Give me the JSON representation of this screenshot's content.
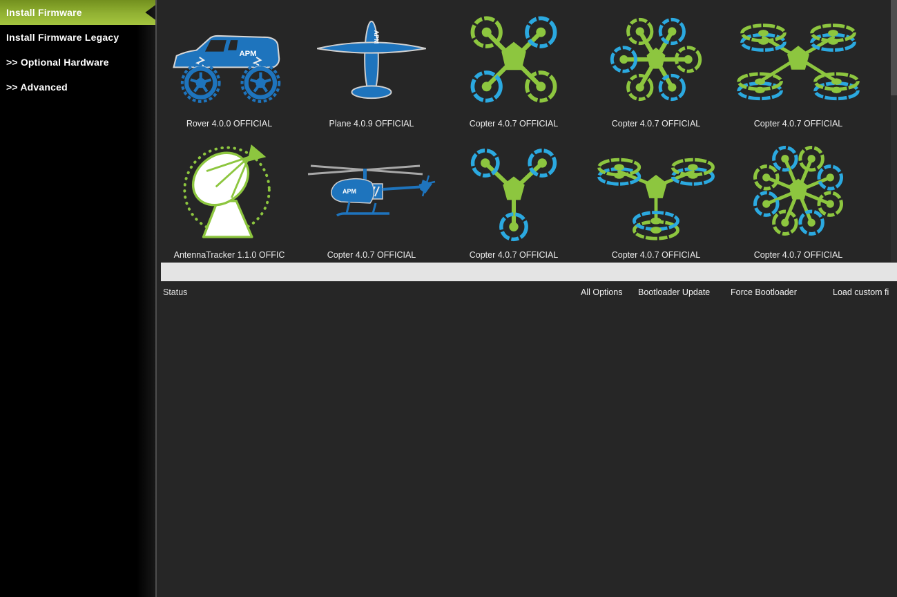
{
  "sidebar": {
    "items": [
      {
        "label": "Install Firmware",
        "selected": true
      },
      {
        "label": "Install Firmware Legacy",
        "selected": false
      },
      {
        "label": ">> Optional Hardware",
        "selected": false
      },
      {
        "label": ">> Advanced",
        "selected": false
      }
    ]
  },
  "firmware_grid": {
    "tiles": [
      {
        "label": "Rover 4.0.0 OFFICIAL",
        "vehicle": "rover"
      },
      {
        "label": "Plane 4.0.9 OFFICIAL",
        "vehicle": "plane"
      },
      {
        "label": "Copter 4.0.7 OFFICIAL",
        "vehicle": "quadcopter"
      },
      {
        "label": "Copter 4.0.7 OFFICIAL",
        "vehicle": "hexacopter"
      },
      {
        "label": "Copter 4.0.7 OFFICIAL",
        "vehicle": "octo-quad-x8"
      },
      {
        "label": "AntennaTracker  1.1.0 OFFIC",
        "vehicle": "antenna-tracker"
      },
      {
        "label": "Copter 4.0.7 OFFICIAL",
        "vehicle": "traditional-heli"
      },
      {
        "label": "Copter 4.0.7 OFFICIAL",
        "vehicle": "tricopter"
      },
      {
        "label": "Copter 4.0.7 OFFICIAL",
        "vehicle": "y6-coax"
      },
      {
        "label": "Copter 4.0.7 OFFICIAL",
        "vehicle": "octocopter"
      }
    ]
  },
  "status_bar": {
    "status_label": "Status",
    "actions": [
      "All Options",
      "Bootloader Update",
      "Force Bootloader",
      "Load custom fi"
    ]
  },
  "colors": {
    "accent_green": "#92b233",
    "icon_green": "#8dc63f",
    "icon_blue": "#2ba9e0",
    "vehicle_blue": "#1e74bd",
    "panel_background": "#262626",
    "progress_track": "#e4e4e4"
  }
}
